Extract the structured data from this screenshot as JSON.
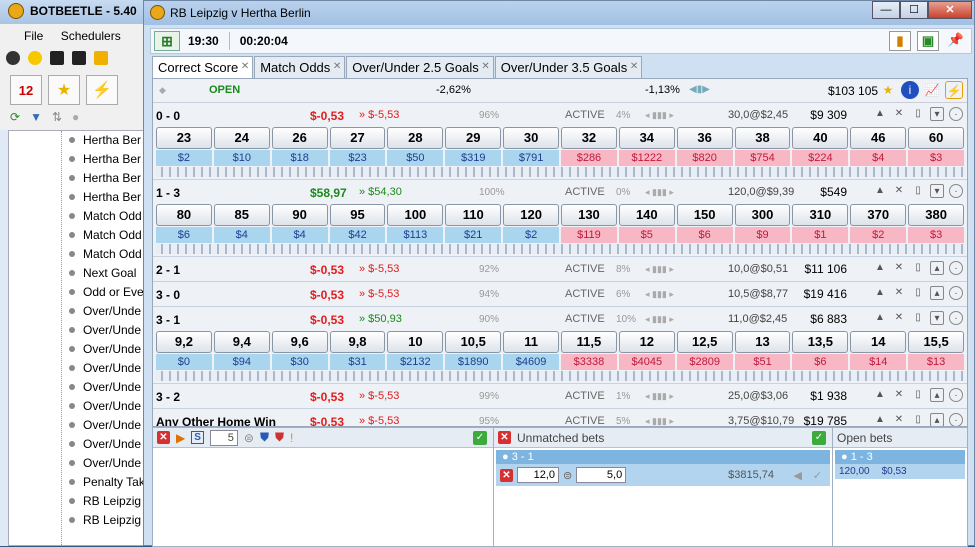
{
  "bg_window": {
    "title": "BOTBEETLE - 5.40",
    "menu": [
      "File",
      "Schedulers"
    ],
    "tree_items": [
      "Hertha Ber",
      "Hertha Ber",
      "Hertha Ber",
      "Hertha Ber",
      "Match Odd",
      "Match Odd",
      "Match Odd",
      "Next Goal",
      "Odd or Eve",
      "Over/Unde",
      "Over/Unde",
      "Over/Unde",
      "Over/Unde",
      "Over/Unde",
      "Over/Unde",
      "Over/Unde",
      "Over/Unde",
      "Over/Unde",
      "Penalty Tak",
      "RB Leipzig",
      "RB Leipzig"
    ]
  },
  "window": {
    "title": "RB Leipzig v Hertha Berlin",
    "time": "19:30",
    "countdown": "00:20:04"
  },
  "tabs": [
    "Correct Score",
    "Match Odds",
    "Over/Under 2.5 Goals",
    "Over/Under 3.5 Goals"
  ],
  "market": {
    "status": "OPEN",
    "pct_back": "-2,62%",
    "pct_lay": "-1,13%",
    "balance": "$103 105"
  },
  "runners": [
    {
      "name": "0 - 0",
      "pl1": "$-0,53",
      "pl1_color": "red",
      "pl2": "» $-5,53",
      "pl2_color": "red",
      "pct": "96%",
      "status": "ACTIVE",
      "pct2": "4%",
      "last": "30,0@$2,45",
      "matched": "$9 309",
      "odds": [
        "23",
        "24",
        "26",
        "27",
        "28",
        "29",
        "30",
        "32",
        "34",
        "36",
        "38",
        "40",
        "46",
        "60"
      ],
      "vols": [
        "$2",
        "$10",
        "$18",
        "$23",
        "$50",
        "$319",
        "$791",
        "$286",
        "$1222",
        "$820",
        "$754",
        "$224",
        "$4",
        "$3"
      ]
    },
    {
      "name": "1 - 3",
      "pl1": "$58,97",
      "pl1_color": "green",
      "pl2": "» $54,30",
      "pl2_color": "green",
      "pct": "100%",
      "status": "ACTIVE",
      "pct2": "0%",
      "last": "120,0@$9,39",
      "matched": "$549",
      "odds": [
        "80",
        "85",
        "90",
        "95",
        "100",
        "110",
        "120",
        "130",
        "140",
        "150",
        "300",
        "310",
        "370",
        "380"
      ],
      "vols": [
        "$6",
        "$4",
        "$4",
        "$42",
        "$113",
        "$21",
        "$2",
        "$119",
        "$5",
        "$6",
        "$9",
        "$1",
        "$2",
        "$3"
      ]
    },
    {
      "name": "2 - 1",
      "pl1": "$-0,53",
      "pl1_color": "red",
      "pl2": "» $-5,53",
      "pl2_color": "red",
      "pct": "92%",
      "status": "ACTIVE",
      "pct2": "8%",
      "last": "10,0@$0,51",
      "matched": "$11 106"
    },
    {
      "name": "3 - 0",
      "pl1": "$-0,53",
      "pl1_color": "red",
      "pl2": "» $-5,53",
      "pl2_color": "red",
      "pct": "94%",
      "status": "ACTIVE",
      "pct2": "6%",
      "last": "10,5@$8,77",
      "matched": "$19 416"
    },
    {
      "name": "3 - 1",
      "pl1": "$-0,53",
      "pl1_color": "red",
      "pl2": "» $50,93",
      "pl2_color": "green",
      "pct": "90%",
      "status": "ACTIVE",
      "pct2": "10%",
      "last": "11,0@$2,45",
      "matched": "$6 883",
      "odds": [
        "9,2",
        "9,4",
        "9,6",
        "9,8",
        "10",
        "10,5",
        "11",
        "11,5",
        "12",
        "12,5",
        "13",
        "13,5",
        "14",
        "15,5"
      ],
      "vols": [
        "$0",
        "$94",
        "$30",
        "$31",
        "$2132",
        "$1890",
        "$4609",
        "$3338",
        "$4045",
        "$2809",
        "$51",
        "$6",
        "$14",
        "$13"
      ]
    },
    {
      "name": "3 - 2",
      "pl1": "$-0,53",
      "pl1_color": "red",
      "pl2": "» $-5,53",
      "pl2_color": "red",
      "pct": "99%",
      "status": "ACTIVE",
      "pct2": "1%",
      "last": "25,0@$3,06",
      "matched": "$1 938"
    },
    {
      "name": "Any Other Home Win",
      "pl1": "$-0,53",
      "pl1_color": "red",
      "pl2": "» $-5,53",
      "pl2_color": "red",
      "pct": "95%",
      "status": "ACTIVE",
      "pct2": "5%",
      "last": "3,75@$10,79",
      "matched": "$19 785"
    }
  ],
  "bottom": {
    "left_stake": "5",
    "unmatched_title": "Unmatched bets",
    "unmatched_selection": "3 - 1",
    "unmatched_odds": "12,0",
    "unmatched_stake": "5,0",
    "unmatched_liability": "$3815,74",
    "open_title": "Open bets",
    "open_selection": "1 - 3",
    "open_odds": "120,00",
    "open_stake": "$0,53"
  }
}
